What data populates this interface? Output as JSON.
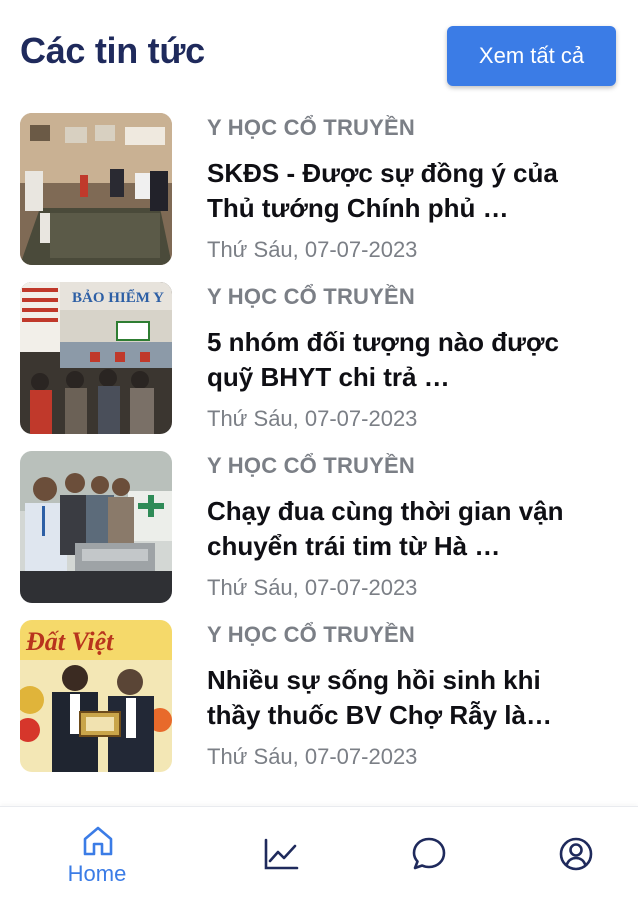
{
  "header": {
    "title": "Các tin tức",
    "see_all_label": "Xem tất cả"
  },
  "news": [
    {
      "category": "Y HỌC CỔ TRUYỀN",
      "headline": "SKĐS - Được sự đồng ý của Thủ tướng Chính phủ …",
      "date": "Thứ Sáu, 07-07-2023",
      "image_icon": "meeting-room-photo"
    },
    {
      "category": "Y HỌC CỔ TRUYỀN",
      "headline": "5 nhóm đối tượng nào được quỹ BHYT chi trả …",
      "date": "Thứ Sáu, 07-07-2023",
      "image_icon": "insurance-counter-photo",
      "image_text": "BẢO HIỂM Y"
    },
    {
      "category": "Y HỌC CỔ TRUYỀN",
      "headline": "Chạy đua cùng thời gian vận chuyển trái tim từ Hà …",
      "date": "Thứ Sáu, 07-07-2023",
      "image_icon": "people-with-cooler-photo"
    },
    {
      "category": "Y HỌC CỔ TRUYỀN",
      "headline": "Nhiều sự sống hồi sinh khi thầy thuốc BV Chợ Rẫy là…",
      "date": "Thứ Sáu, 07-07-2023",
      "image_icon": "award-ceremony-photo",
      "image_text": "Đất Việt"
    }
  ],
  "bottom_nav": {
    "items": [
      {
        "label": "Home",
        "icon": "home-icon",
        "active": true
      },
      {
        "label": "",
        "icon": "chart-icon",
        "active": false
      },
      {
        "label": "",
        "icon": "chat-icon",
        "active": false
      },
      {
        "label": "",
        "icon": "profile-icon",
        "active": false
      }
    ]
  },
  "colors": {
    "title": "#1f2a5c",
    "accent": "#3b7ce6",
    "nav_inactive": "#1f2a5c",
    "muted": "#7b7f86"
  }
}
